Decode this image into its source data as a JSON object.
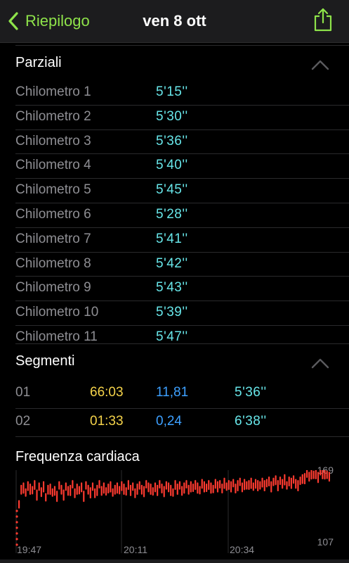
{
  "nav": {
    "back_label": "Riepilogo",
    "title": "ven 8 ott",
    "accent": "#8ee34a"
  },
  "splits": {
    "title": "Parziali",
    "rows": [
      {
        "label": "Chilometro 1",
        "pace": "5'15''"
      },
      {
        "label": "Chilometro 2",
        "pace": "5'30''"
      },
      {
        "label": "Chilometro 3",
        "pace": "5'36''"
      },
      {
        "label": "Chilometro 4",
        "pace": "5'40''"
      },
      {
        "label": "Chilometro 5",
        "pace": "5'45''"
      },
      {
        "label": "Chilometro 6",
        "pace": "5'28''"
      },
      {
        "label": "Chilometro 7",
        "pace": "5'41''"
      },
      {
        "label": "Chilometro 8",
        "pace": "5'42''"
      },
      {
        "label": "Chilometro 9",
        "pace": "5'43''"
      },
      {
        "label": "Chilometro 10",
        "pace": "5'39''"
      },
      {
        "label": "Chilometro 11",
        "pace": "5'47''"
      }
    ]
  },
  "segments": {
    "title": "Segmenti",
    "rows": [
      {
        "id": "01",
        "time": "66:03",
        "distance": "11,81",
        "pace": "5'36''"
      },
      {
        "id": "02",
        "time": "01:33",
        "distance": "0,24",
        "pace": "6'38''"
      }
    ]
  },
  "heart_rate": {
    "title": "Frequenza cardiaca",
    "max_label": "169",
    "min_label": "107",
    "time_labels": [
      "19:47",
      "20:11",
      "20:34"
    ],
    "color": "#ff3b30"
  },
  "chart_data": {
    "type": "bar",
    "title": "Frequenza cardiaca",
    "ylim": [
      107,
      169
    ],
    "x_ticks": [
      "19:47",
      "20:11",
      "20:34"
    ],
    "series": [
      {
        "values": [
          140,
          153,
          155,
          150,
          156,
          154,
          152,
          157,
          149,
          155,
          151,
          156,
          146,
          153,
          154,
          150,
          152,
          148,
          156,
          153,
          149,
          155,
          152,
          153,
          157,
          150,
          154,
          152,
          155,
          148,
          156,
          153,
          151,
          155,
          150,
          153,
          157,
          152,
          155,
          151,
          154,
          156,
          150,
          153,
          155,
          152,
          156,
          154,
          151,
          157,
          153,
          155,
          150,
          154,
          156,
          153,
          152,
          157,
          155,
          154,
          151,
          155,
          153,
          157,
          154,
          152,
          156,
          155,
          153,
          150,
          157,
          154,
          156,
          152,
          155,
          157,
          153,
          156,
          154,
          157,
          155,
          152,
          158,
          156,
          154,
          157,
          155,
          153,
          158,
          156,
          157,
          154,
          159,
          155,
          157,
          156,
          158,
          154,
          157,
          159,
          155,
          158,
          156,
          157,
          159,
          155,
          158,
          157,
          156,
          159,
          157,
          158,
          160,
          156,
          159,
          161,
          157,
          160,
          158,
          162,
          156,
          160,
          159,
          161,
          158,
          157,
          160,
          162,
          163,
          166,
          164,
          167,
          165,
          166,
          164,
          168,
          166,
          167,
          165,
          164
        ]
      }
    ]
  }
}
